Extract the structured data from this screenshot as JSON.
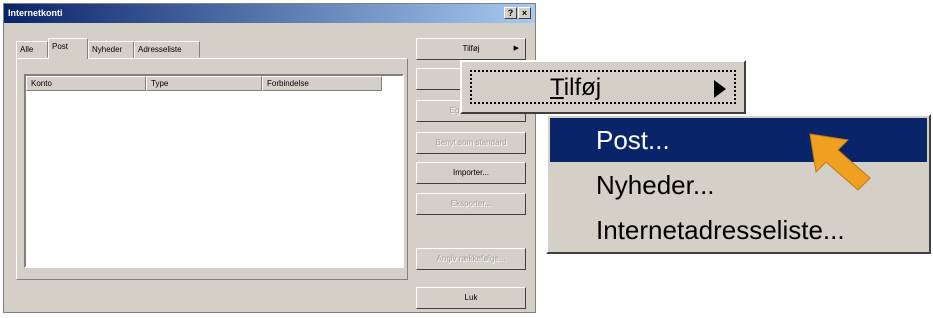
{
  "window": {
    "title": "Internetkonti",
    "help_glyph": "?",
    "close_glyph": "×"
  },
  "tabs": [
    "Alle",
    "Post",
    "Nyheder",
    "Adresseliste"
  ],
  "active_tab": "Post",
  "listview": {
    "columns": [
      "Konto",
      "Type",
      "Forbindelse"
    ]
  },
  "buttons": {
    "add": "Tilføj",
    "remove": "",
    "properties": "Egenskaber",
    "set_default": "Benyt som standard",
    "import": "Importer...",
    "export": "Eksporter...",
    "set_order": "Angiv rækkefølge...",
    "close": "Luk"
  },
  "zoom_menu": {
    "tilfoj_prefix": "T",
    "tilfoj_rest": "ilføj",
    "items": [
      "Post...",
      "Nyheder...",
      "Internetadresseliste..."
    ],
    "selected_index": 0
  },
  "colors": {
    "selection": "#0a246a",
    "pointer": "#f0a020"
  }
}
